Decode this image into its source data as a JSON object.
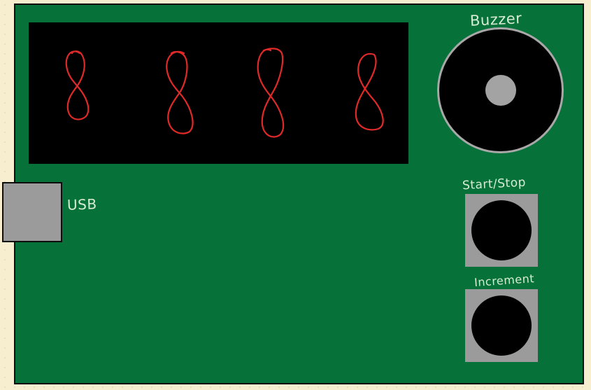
{
  "board": {
    "usb_label": "USB",
    "buzzer_label": "Buzzer",
    "start_stop_label": "Start/Stop",
    "increment_label": "Increment"
  },
  "display": {
    "digits": [
      "8",
      "8",
      "8",
      "8"
    ],
    "segment_color": "#e02a2a",
    "background_color": "#000000"
  },
  "colors": {
    "pcb": "#06723a",
    "component_gray": "#9b9b9b",
    "label_ink": "#d8ecd4"
  }
}
